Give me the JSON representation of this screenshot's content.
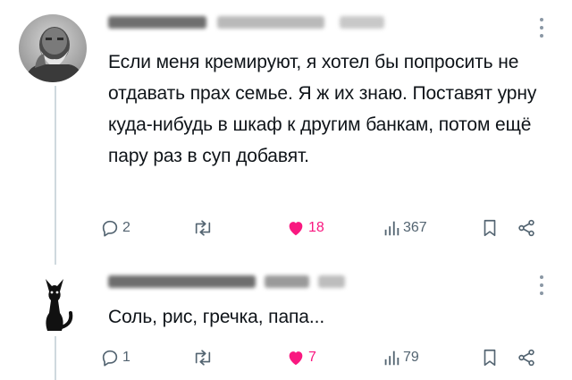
{
  "tweets": [
    {
      "avatar_icon": "old-man-avatar",
      "text": "Если меня кремируют, я хотел бы попросить не отдавать прах семье. Я ж их знаю. Поставят урну куда-нибудь в шкаф к другим банкам, потом ещё пару раз в суп добавят.",
      "actions": {
        "replies": "2",
        "retweets": "",
        "likes": "18",
        "views": "367"
      }
    },
    {
      "avatar_icon": "black-cat-avatar",
      "text": "Соль, рис, гречка, папа...",
      "actions": {
        "replies": "1",
        "retweets": "",
        "likes": "7",
        "views": "79"
      }
    }
  ],
  "colors": {
    "like_pink": "#f91880",
    "icon_gray": "#536471",
    "thread_line": "#cfd9de"
  }
}
